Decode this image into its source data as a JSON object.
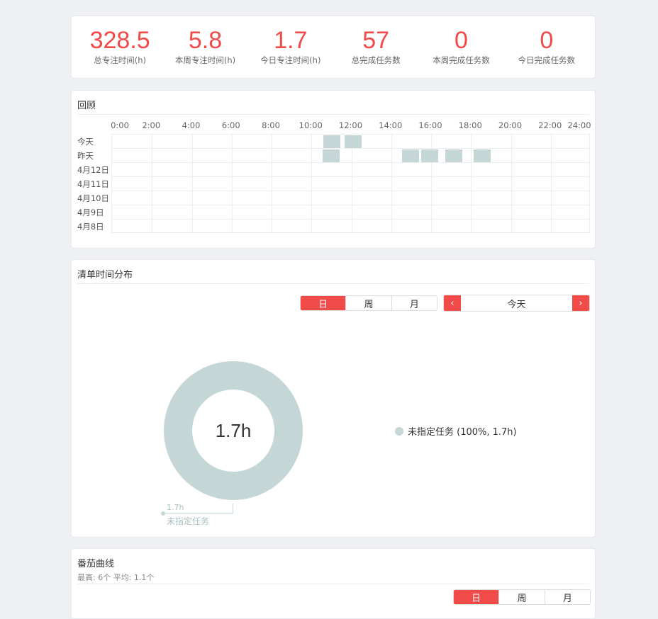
{
  "stats": [
    {
      "value": "328.5",
      "label": "总专注时间(h)"
    },
    {
      "value": "5.8",
      "label": "本周专注时间(h)"
    },
    {
      "value": "1.7",
      "label": "今日专注时间(h)"
    },
    {
      "value": "57",
      "label": "总完成任务数"
    },
    {
      "value": "0",
      "label": "本周完成任务数"
    },
    {
      "value": "0",
      "label": "今日完成任务数"
    }
  ],
  "review": {
    "title": "回顾",
    "ticks": [
      "0:00",
      "2:00",
      "4:00",
      "6:00",
      "8:00",
      "10:00",
      "12:00",
      "14:00",
      "16:00",
      "18:00",
      "20:00",
      "22:00",
      "24:00"
    ],
    "rows": [
      "今天",
      "昨天",
      "4月12日",
      "4月11日",
      "4月10日",
      "4月9日",
      "4月8日"
    ],
    "sessions": [
      {
        "row": 0,
        "start": 10.6,
        "end": 11.45
      },
      {
        "row": 0,
        "start": 11.65,
        "end": 12.5
      },
      {
        "row": 1,
        "start": 10.55,
        "end": 11.4
      },
      {
        "row": 1,
        "start": 14.55,
        "end": 15.4
      },
      {
        "row": 1,
        "start": 15.5,
        "end": 16.35
      },
      {
        "row": 1,
        "start": 16.7,
        "end": 17.55
      },
      {
        "row": 1,
        "start": 18.15,
        "end": 19.0
      }
    ],
    "block_color": "#c5d6d6"
  },
  "distribution": {
    "title": "清单时间分布",
    "periods": [
      "日",
      "周",
      "月"
    ],
    "active_period": 0,
    "date_label": "今天",
    "prev_icon": "‹",
    "next_icon": "›",
    "total": "1.7h",
    "legend": "未指定任务 (100%, 1.7h)",
    "callout_value": "1.7h",
    "callout_label": "未指定任务",
    "slice_color": "#c5d6d6"
  },
  "tomato": {
    "title": "番茄曲线",
    "subtitle": "最高: 6个 平均: 1.1个",
    "periods": [
      "日",
      "周",
      "月"
    ],
    "active_period": 0
  },
  "colors": {
    "accent": "#f04a49"
  }
}
